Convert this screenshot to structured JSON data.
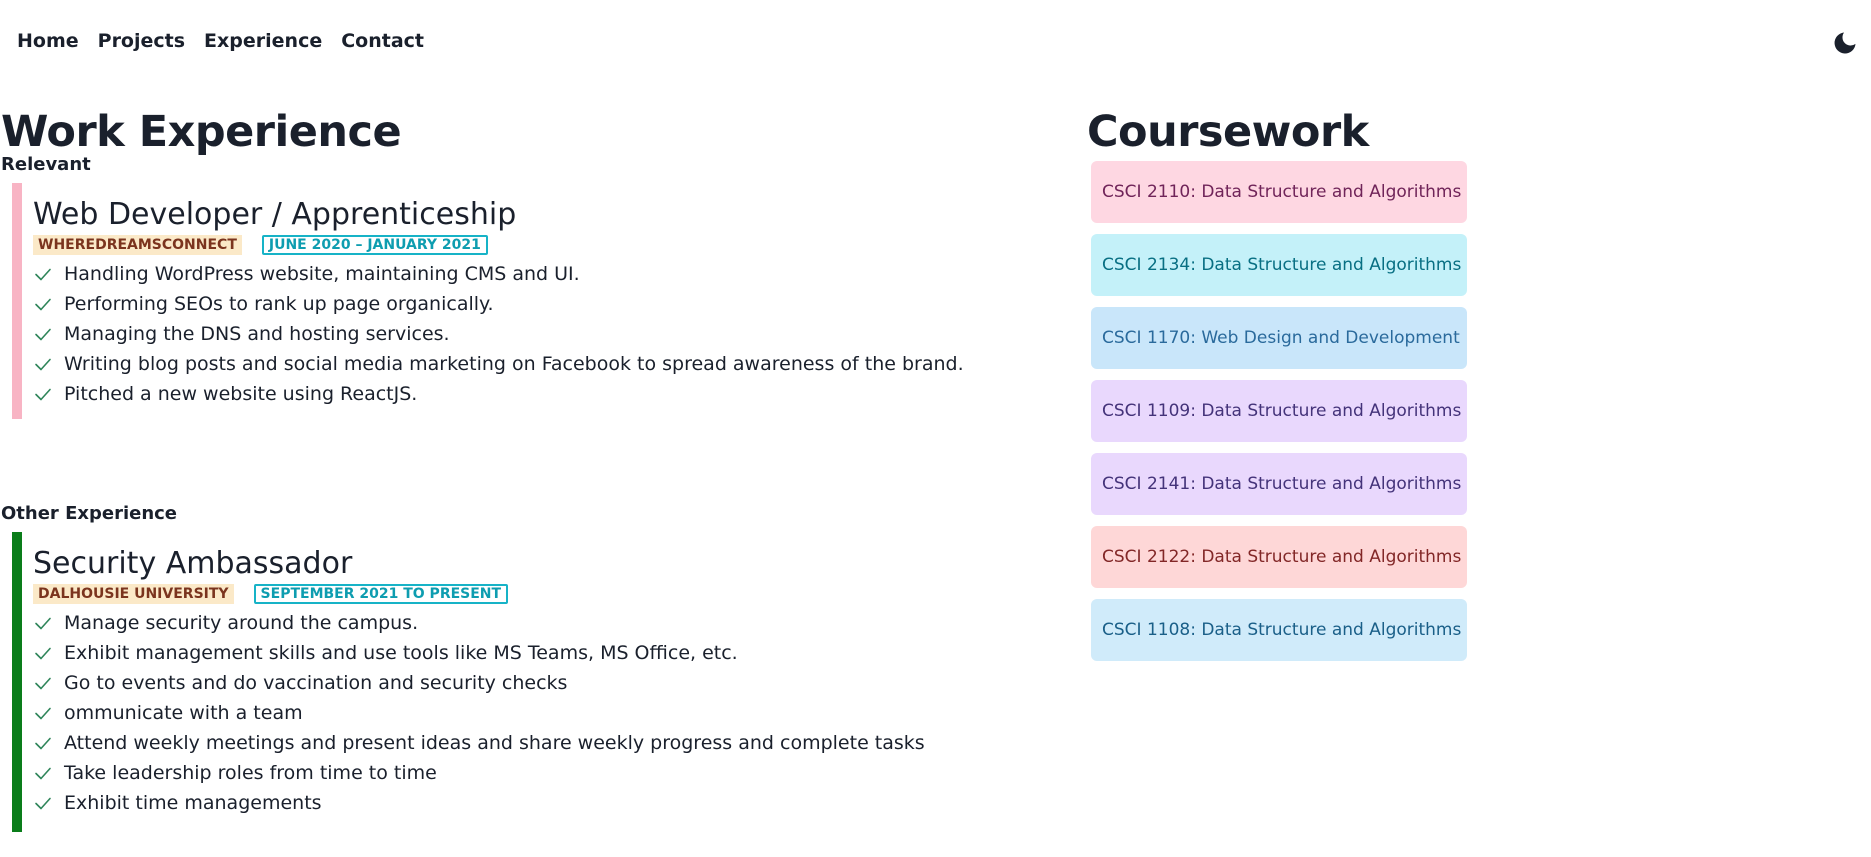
{
  "nav": {
    "items": [
      "Home",
      "Projects",
      "Experience",
      "Contact"
    ]
  },
  "theme_toggle": {
    "icon": "moon-icon"
  },
  "work": {
    "title": "Work Experience",
    "relevant": {
      "label": "Relevant",
      "bar_color": "#f8b4c4",
      "title": "Web Developer / Apprenticeship",
      "company": "WHEREDREAMSCONNECT",
      "date": "JUNE 2020 – JANUARY 2021",
      "duties": [
        "Handling WordPress website, maintaining CMS and UI.",
        "Performing SEOs to rank up page organically.",
        "Managing the DNS and hosting services.",
        "Writing blog posts and social media marketing on Facebook to spread awareness of the brand.",
        "Pitched a new website using ReactJS."
      ]
    },
    "other": {
      "label": "Other Experience",
      "bar_color": "#0a7d1a",
      "title": "Security Ambassador",
      "company": "DALHOUSIE UNIVERSITY",
      "date": "SEPTEMBER 2021 TO PRESENT",
      "duties": [
        "Manage security around the campus.",
        "Exhibit management skills and use tools like MS Teams, MS Office, etc.",
        "Go to events and do vaccination and security checks",
        "ommunicate with a team",
        "Attend weekly meetings and present ideas and share weekly progress and complete tasks",
        "Take leadership roles from time to time",
        "Exhibit time managements"
      ]
    }
  },
  "coursework": {
    "title": "Coursework",
    "courses": [
      {
        "label": "CSCI 2110: Data Structure and Algorithms",
        "bg": "#fed7e2",
        "color": "#702459"
      },
      {
        "label": "CSCI 2134: Data Structure and Algorithms",
        "bg": "#c4f1f9",
        "color": "#086f83"
      },
      {
        "label": "CSCI 1170: Web Design and Development",
        "bg": "#c9e6fa",
        "color": "#2a6a9c"
      },
      {
        "label": "CSCI 1109: Data Structure and Algorithms",
        "bg": "#e9d8fd",
        "color": "#44337a"
      },
      {
        "label": "CSCI 2141: Data Structure and Algorithms",
        "bg": "#e9d8fd",
        "color": "#44337a"
      },
      {
        "label": "CSCI 2122: Data Structure and Algorithms",
        "bg": "#fed7d7",
        "color": "#822727"
      },
      {
        "label": "CSCI 1108: Data Structure and Algorithms",
        "bg": "#d0ebfa",
        "color": "#1a5f88"
      }
    ]
  },
  "colors": {
    "check": "#2f855a",
    "text": "#1a202c"
  }
}
